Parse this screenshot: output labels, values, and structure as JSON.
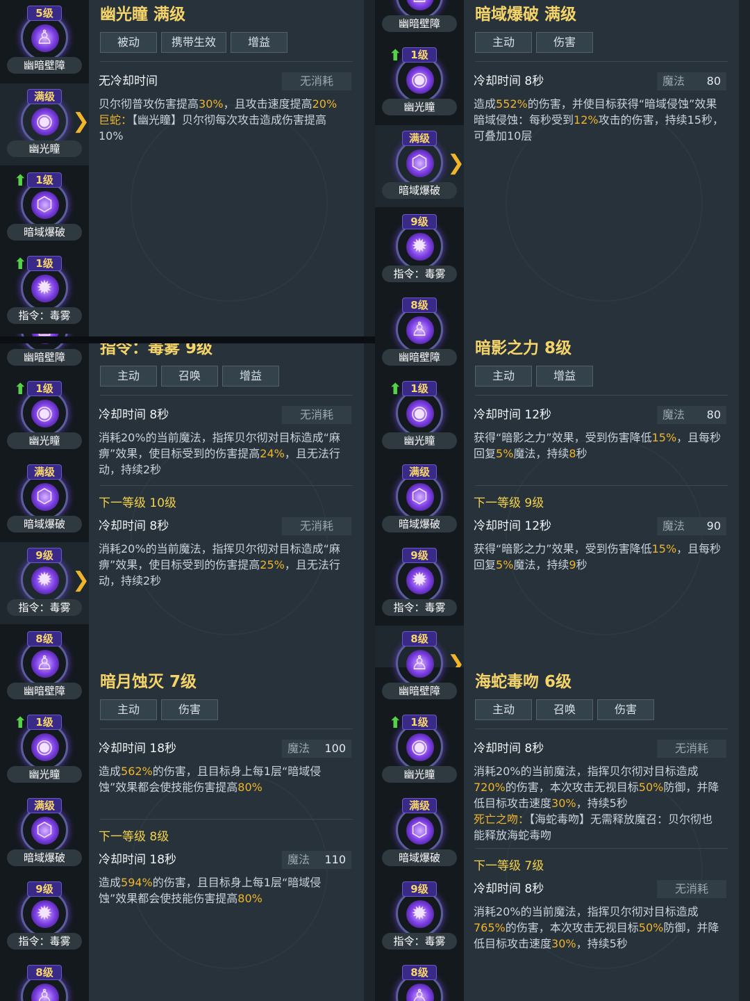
{
  "cells": [
    {
      "sidebar": [
        {
          "level": "5级",
          "name": "幽暗壁障",
          "up": false,
          "arrow": false,
          "selected": false
        },
        {
          "level": "满级",
          "name": "幽光瞳",
          "up": false,
          "arrow": true,
          "selected": true
        },
        {
          "level": "1级",
          "name": "暗域爆破",
          "up": true,
          "arrow": false,
          "selected": false
        },
        {
          "level": "1级",
          "name": "指令：毒雾",
          "up": true,
          "arrow": false,
          "selected": false
        }
      ],
      "title": "幽光瞳 满级",
      "tags": [
        "被动",
        "携带生效",
        "增益"
      ],
      "cooldown": "无冷却时间",
      "cost": "无消耗",
      "desc_html": "贝尔彻普攻伤害提高<span class='gold'>30%</span>，且攻击速度提高<span class='gold'>20%</span><br><span class='gold'>巨蛇：</span>【幽光瞳】贝尔彻每次攻击造成伤害提高10%"
    },
    {
      "sidebar": [
        {
          "level": "",
          "name": "幽暗壁障",
          "up": false,
          "arrow": false,
          "selected": false
        },
        {
          "level": "1级",
          "name": "幽光瞳",
          "up": true,
          "arrow": false,
          "selected": false
        },
        {
          "level": "满级",
          "name": "暗域爆破",
          "up": false,
          "arrow": true,
          "selected": true
        },
        {
          "level": "9级",
          "name": "指令：毒雾",
          "up": false,
          "arrow": false,
          "selected": false
        },
        {
          "level": "8级",
          "name": "幽暗壁障",
          "up": false,
          "arrow": false,
          "selected": false
        }
      ],
      "title": "暗域爆破 满级",
      "tags": [
        "主动",
        "伤害"
      ],
      "cooldown": "冷却时间 8秒",
      "cost": "魔法 80",
      "desc_html": "造成<span class='gold'>552%</span>的伤害，并使目标获得“暗域侵蚀”效果<br>暗域侵蚀：每秒受到<span class='gold'>12%</span>攻击的伤害，持续15秒，可叠加10层"
    },
    {
      "sidebar": [
        {
          "level": "",
          "name": "幽暗壁障",
          "up": false,
          "arrow": false,
          "selected": false
        },
        {
          "level": "1级",
          "name": "幽光瞳",
          "up": true,
          "arrow": false,
          "selected": false
        },
        {
          "level": "满级",
          "name": "暗域爆破",
          "up": false,
          "arrow": false,
          "selected": false
        },
        {
          "level": "9级",
          "name": "指令：毒雾",
          "up": false,
          "arrow": true,
          "selected": true
        },
        {
          "level": "8级",
          "name": "幽暗壁障",
          "up": false,
          "arrow": false,
          "selected": false
        }
      ],
      "title": "指令：毒雾 9级",
      "tags": [
        "主动",
        "召唤",
        "增益"
      ],
      "cooldown": "冷却时间 8秒",
      "cost": "无消耗",
      "desc_html": "消耗20%的当前魔法，指挥贝尔彻对目标造成“麻痹”效果，使目标受到的伤害提高<span class='gold'>24%</span>，且无法行动，持续2秒",
      "next": {
        "label": "下一等级 10级",
        "cooldown": "冷却时间 8秒",
        "cost": "无消耗",
        "desc_html": "消耗20%的当前魔法，指挥贝尔彻对目标造成“麻痹”效果，使目标受到的伤害提高<span class='gold'>25%</span>，且无法行动，持续2秒"
      }
    },
    {
      "sidebar": [
        {
          "level": "",
          "name": "幽暗壁障",
          "up": false,
          "arrow": false,
          "selected": false
        },
        {
          "level": "1级",
          "name": "幽光瞳",
          "up": true,
          "arrow": false,
          "selected": false
        },
        {
          "level": "满级",
          "name": "暗域爆破",
          "up": false,
          "arrow": false,
          "selected": false
        },
        {
          "level": "9级",
          "name": "指令：毒雾",
          "up": false,
          "arrow": false,
          "selected": false
        },
        {
          "level": "8级",
          "name": "幽暗壁障",
          "up": false,
          "arrow": true,
          "selected": true
        }
      ],
      "title": "暗影之力 8级",
      "tags": [
        "主动",
        "增益"
      ],
      "cooldown": "冷却时间 12秒",
      "cost": "魔法 80",
      "desc_html": "获得“暗影之力”效果，受到伤害降低<span class='gold'>15%</span>，且每秒回复<span class='gold'>5%</span>魔法，持续<span class='gold'>8</span>秒",
      "next": {
        "label": "下一等级 9级",
        "cooldown": "冷却时间 12秒",
        "cost": "魔法 90",
        "desc_html": "获得“暗影之力”效果，受到伤害降低<span class='gold'>15%</span>，且每秒回复<span class='gold'>5%</span>魔法，持续<span class='gold'>9</span>秒"
      }
    },
    {
      "sidebar": [
        {
          "level": "8级",
          "name": "幽暗壁障",
          "up": false,
          "arrow": false,
          "selected": false
        },
        {
          "level": "1级",
          "name": "幽光瞳",
          "up": true,
          "arrow": false,
          "selected": false
        },
        {
          "level": "满级",
          "name": "暗域爆破",
          "up": false,
          "arrow": false,
          "selected": false
        },
        {
          "level": "9级",
          "name": "指令：毒雾",
          "up": false,
          "arrow": false,
          "selected": false
        },
        {
          "level": "8级",
          "name": "",
          "up": false,
          "arrow": false,
          "selected": false
        }
      ],
      "title": "暗月蚀灭 7级",
      "tags": [
        "主动",
        "伤害"
      ],
      "cooldown": "冷却时间 18秒",
      "cost": "魔法 100",
      "desc_html": "造成<span class='gold'>562%</span>的伤害，且目标身上每1层“暗域侵蚀”效果都会使技能伤害提高<span class='gold'>80%</span>",
      "next": {
        "label": "下一等级 8级",
        "cooldown": "冷却时间 18秒",
        "cost": "魔法 110",
        "desc_html": "造成<span class='gold'>594%</span>的伤害，且目标身上每1层“暗域侵蚀”效果都会使技能伤害提高<span class='gold'>80%</span>"
      }
    },
    {
      "sidebar": [
        {
          "level": "",
          "name": "幽暗壁障",
          "up": false,
          "arrow": false,
          "selected": false
        },
        {
          "level": "1级",
          "name": "幽光瞳",
          "up": true,
          "arrow": false,
          "selected": false
        },
        {
          "level": "满级",
          "name": "暗域爆破",
          "up": false,
          "arrow": false,
          "selected": false
        },
        {
          "level": "9级",
          "name": "指令：毒雾",
          "up": false,
          "arrow": false,
          "selected": false
        },
        {
          "level": "8级",
          "name": "",
          "up": false,
          "arrow": false,
          "selected": false
        }
      ],
      "title": "海蛇毒吻 6级",
      "tags": [
        "主动",
        "召唤",
        "伤害"
      ],
      "cooldown": "冷却时间 8秒",
      "cost": "无消耗",
      "desc_html": "消耗20%的当前魔法，指挥贝尔彻对目标造成<span class='gold'>720%</span>的伤害，本次攻击无视目标<span class='gold'>50%</span>防御，并降低目标攻击速度<span class='gold'>30%</span>，持续5秒<br><span class='gold'>死亡之吻：</span>【海蛇毒吻】无需释放魔召：贝尔彻也能释放海蛇毒吻",
      "next": {
        "label": "下一等级 7级",
        "cooldown": "冷却时间 8秒",
        "cost": "无消耗",
        "desc_html": "消耗20%的当前魔法，指挥贝尔彻对目标造成<span class='gold'>765%</span>的伤害，本次攻击无视目标<span class='gold'>50%</span>防御，并降低目标攻击速度<span class='gold'>30%</span>，持续5秒"
      }
    }
  ]
}
